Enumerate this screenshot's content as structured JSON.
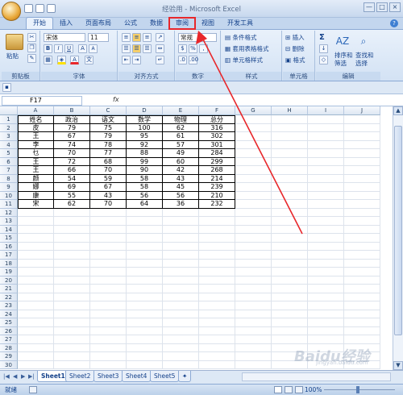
{
  "window": {
    "title": "经验用 - Microsoft Excel",
    "controls": [
      "—",
      "□",
      "×"
    ]
  },
  "tabs": [
    {
      "label": "开始",
      "active": true
    },
    {
      "label": "插入"
    },
    {
      "label": "页面布局"
    },
    {
      "label": "公式"
    },
    {
      "label": "数据"
    },
    {
      "label": "审阅",
      "highlighted": true
    },
    {
      "label": "视图"
    },
    {
      "label": "开发工具"
    }
  ],
  "ribbon": {
    "clipboard": {
      "paste": "粘贴",
      "label": "剪贴板"
    },
    "font": {
      "name": "宋体",
      "size": "11",
      "bold": "B",
      "italic": "I",
      "underline": "U",
      "grow": "A",
      "shrink": "A",
      "color_a": "A",
      "wen": "文",
      "label": "字体"
    },
    "alignment": {
      "label": "对齐方式"
    },
    "number": {
      "format": "常规",
      "label": "数字"
    },
    "styles": {
      "cond": "条件格式",
      "table": "套用表格格式",
      "cell": "单元格样式",
      "label": "样式"
    },
    "cells": {
      "insert": "插入",
      "delete": "删除",
      "format": "格式",
      "label": "单元格"
    },
    "editing": {
      "sigma": "Σ",
      "sort": "排序和",
      "sort2": "筛选",
      "find": "查找和",
      "find2": "选择",
      "label": "编辑"
    }
  },
  "formula_bar": {
    "name_box": "F17",
    "fx": "fx",
    "content": ""
  },
  "columns": [
    "A",
    "B",
    "C",
    "D",
    "E",
    "F",
    "G",
    "H",
    "I",
    "J"
  ],
  "rows": [
    "1",
    "2",
    "3",
    "4",
    "5",
    "6",
    "7",
    "8",
    "9",
    "10",
    "11",
    "12",
    "13",
    "14",
    "15",
    "16",
    "17",
    "18",
    "19",
    "20",
    "21",
    "22",
    "23",
    "24",
    "25",
    "26",
    "27",
    "28",
    "29",
    "30"
  ],
  "table": [
    [
      "姓名",
      "政治",
      "语文",
      "数学",
      "物理",
      "总分"
    ],
    [
      "皮",
      "79",
      "75",
      "100",
      "62",
      "316"
    ],
    [
      "王",
      "67",
      "79",
      "95",
      "61",
      "302"
    ],
    [
      "李",
      "74",
      "78",
      "92",
      "57",
      "301"
    ],
    [
      "乜",
      "70",
      "77",
      "88",
      "49",
      "284"
    ],
    [
      "王",
      "72",
      "68",
      "99",
      "60",
      "299"
    ],
    [
      "王",
      "66",
      "70",
      "90",
      "42",
      "268"
    ],
    [
      "颜",
      "54",
      "59",
      "58",
      "43",
      "214"
    ],
    [
      "娜",
      "69",
      "67",
      "58",
      "45",
      "239"
    ],
    [
      "康",
      "55",
      "43",
      "56",
      "56",
      "210"
    ],
    [
      "宋",
      "62",
      "70",
      "64",
      "36",
      "232"
    ]
  ],
  "sheets": [
    "Sheet1",
    "Sheet2",
    "Sheet3",
    "Sheet4",
    "Sheet5"
  ],
  "active_sheet": "Sheet1",
  "status": {
    "ready": "就绪",
    "zoom": "100%"
  },
  "watermark": {
    "text": "Baidu经验",
    "sub": "jingyan.baidu.com"
  },
  "annotation_color": "#e8272b"
}
